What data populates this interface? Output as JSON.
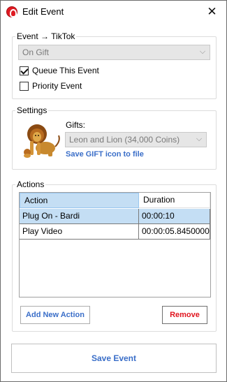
{
  "window": {
    "title": "Edit Event"
  },
  "event_group": {
    "label": "Event → TikTok",
    "event_type": "On Gift",
    "queue_label": "Queue This Event",
    "queue_checked": true,
    "priority_label": "Priority Event",
    "priority_checked": false
  },
  "settings_group": {
    "label": "Settings",
    "gifts_label": "Gifts:",
    "gift_selected": "Leon and Lion (34,000 Coins)",
    "save_icon_link": "Save GIFT icon to file"
  },
  "actions_group": {
    "label": "Actions",
    "columns": [
      "Action",
      "Duration"
    ],
    "rows": [
      {
        "action": "Plug On - Bardi",
        "duration": "00:00:10",
        "selected": true
      },
      {
        "action": "Play Video",
        "duration": "00:00:05.8450000",
        "selected": false
      }
    ],
    "add_button": "Add New Action",
    "remove_button": "Remove"
  },
  "footer": {
    "save_button": "Save Event"
  },
  "colors": {
    "link_blue": "#3a6ec8",
    "remove_red": "#e0141e",
    "selection": "#c4def4"
  }
}
